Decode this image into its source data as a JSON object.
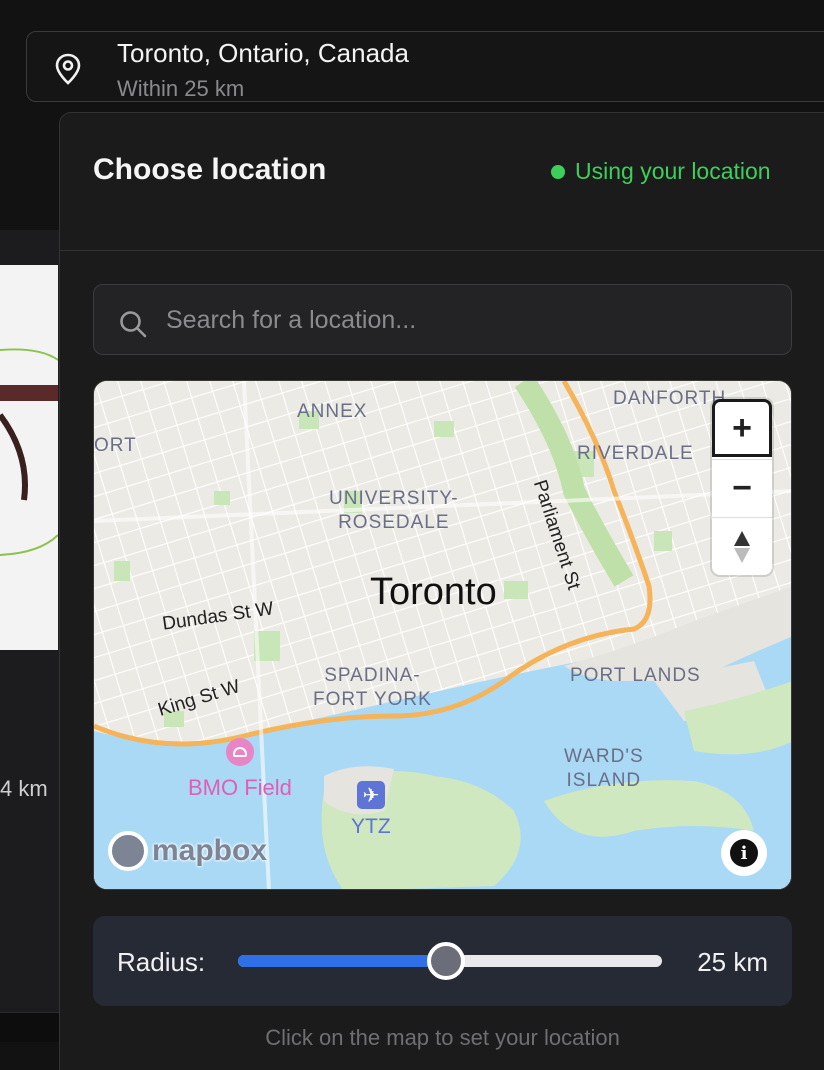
{
  "location_trigger": {
    "title": "Toronto, Ontario, Canada",
    "subtitle": "Within 25 km",
    "icon": "map-pin-icon"
  },
  "background": {
    "distance_text": "4 km"
  },
  "panel": {
    "title": "Choose location",
    "status": {
      "text": "Using your location",
      "color": "#3ecf5a"
    }
  },
  "search": {
    "placeholder": "Search for a location...",
    "value": "",
    "icon": "search-icon"
  },
  "map": {
    "city_label": "Toronto",
    "neighbourhoods": [
      "ANNEX",
      "DANFORTH",
      "RIVERDALE",
      "UNIVERSITY-\nROSEDALE",
      "SPADINA-\nFORT YORK",
      "PORT LANDS",
      "WARD'S\nISLAND"
    ],
    "streets": [
      "Dundas St W",
      "King St W",
      "Parliament St"
    ],
    "partial_labels": [
      "ORT"
    ],
    "pois": {
      "stadium": "BMO Field",
      "airport": "YTZ"
    },
    "controls": {
      "zoom_in": "+",
      "zoom_out": "−",
      "compass_icon": "compass-icon"
    },
    "attribution": {
      "logo_text": "mapbox",
      "info_icon": "info-icon"
    },
    "colors": {
      "water": "#a9d9f5",
      "land": "#eceae4",
      "park": "#c8e6b8",
      "highway": "#f5b35a"
    }
  },
  "radius": {
    "label": "Radius:",
    "value_text": "25 km",
    "fraction": 0.49,
    "accent": "#2f6fe8"
  },
  "hint": "Click on the map to set your location"
}
